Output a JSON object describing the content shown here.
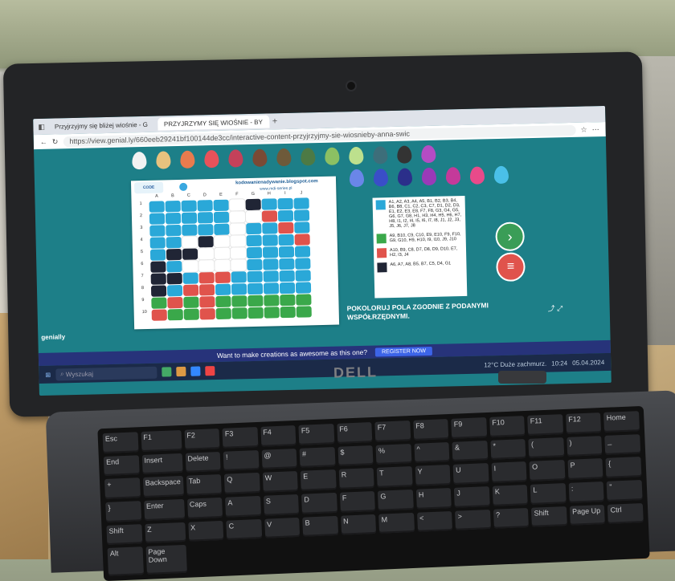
{
  "browser": {
    "tabs": [
      {
        "label": "Przyjrzyjmy się bliżej wiośnie - G",
        "active": false
      },
      {
        "label": "PRZYJRZYMY SIĘ WIOŚNIE - BY",
        "active": true
      }
    ],
    "new_tab_symbol": "+",
    "url": "https://view.genial.ly/660eeb29241bf100144de3cc/interactive-content-przyjrzyjmy-sie-wiosnieby-anna-swic"
  },
  "activity": {
    "header_site": "kodowanienadywanie.blogspot.com",
    "header_site2": "www.mdi-series.pl",
    "columns": [
      "A",
      "B",
      "C",
      "D",
      "E",
      "F",
      "G",
      "H",
      "I",
      "J"
    ],
    "rows": [
      "1",
      "2",
      "3",
      "4",
      "5",
      "6",
      "7",
      "8",
      "9",
      "10"
    ],
    "legend": [
      {
        "color": "#2aa8d8",
        "cells": "A1, A2, A3, A4, A5, B1, B2, B3, B4, B6, B8, C1, C2, C3, C7, D1, D2, D3, E1, E2, E3, E8, F7, F8, G3, G4, G5, G6, G7, G8, H1, H3, H4, H5, H6, H7, H8, I1, I2, I4, I5, I6, I7, I8, J1, J2, J3, J5, J6, J7, J8"
      },
      {
        "color": "#3aa84a",
        "cells": "A9, B10, C9, C10, E9, E10, F9, F10, G9, G10, H9, H10, I9, I10, J9, J10"
      },
      {
        "color": "#e0534c",
        "cells": "A10, B9, C8, D7, D8, D9, D10, E7, H2, I3, J4"
      },
      {
        "color": "#202535",
        "cells": "A6, A7, A8, B5, B7, C5, D4, G1"
      }
    ],
    "instruction": "POKOLORUJ POLA ZGODNIE Z PODANYMI WSPÓŁRZĘDNYMI.",
    "next_symbol": "›",
    "menu_symbol": "≡"
  },
  "palette_top": [
    "#f2f2f2",
    "#e8c27e",
    "#e87b4e",
    "#e8525a",
    "#c4415a",
    "#7a4a35",
    "#6e5a3a",
    "#4d7a45",
    "#8cc063",
    "#bde08d",
    "#3d6e7a",
    "#333333",
    "#b44cc4"
  ],
  "palette_bottom": [
    "#6a86e8",
    "#3a4ec8",
    "#2b2f8a",
    "#9a3ab8",
    "#c43a9a",
    "#e84a8a",
    "#4ac0e8"
  ],
  "genially_promo": {
    "text": "Want to make creations as awesome as this one?",
    "button": "REGISTER NOW",
    "brand": "genially"
  },
  "taskbar": {
    "search_placeholder": "Wyszukaj",
    "weather": "12°C  Duże zachmurz.",
    "time": "10:24",
    "date": "05.04.2024"
  },
  "laptop": {
    "brand": "DELL",
    "keys": [
      "Esc",
      "F1",
      "F2",
      "F3",
      "F4",
      "F5",
      "F6",
      "F7",
      "F8",
      "F9",
      "F10",
      "F11",
      "F12",
      "Home",
      "End",
      "Insert",
      "Delete",
      "!",
      "@",
      "#",
      "$",
      "%",
      "^",
      "&",
      "*",
      "(",
      ")",
      "_",
      "+",
      "Backspace",
      "Tab",
      "Q",
      "W",
      "E",
      "R",
      "T",
      "Y",
      "U",
      "I",
      "O",
      "P",
      "{",
      "}",
      "Enter",
      "Caps",
      "A",
      "S",
      "D",
      "F",
      "G",
      "H",
      "J",
      "K",
      "L",
      ":",
      "\"",
      "Shift",
      "Z",
      "X",
      "C",
      "V",
      "B",
      "N",
      "M",
      "<",
      ">",
      "?",
      "Shift",
      "Page Up",
      "Ctrl",
      "Alt",
      "Page Down"
    ]
  }
}
